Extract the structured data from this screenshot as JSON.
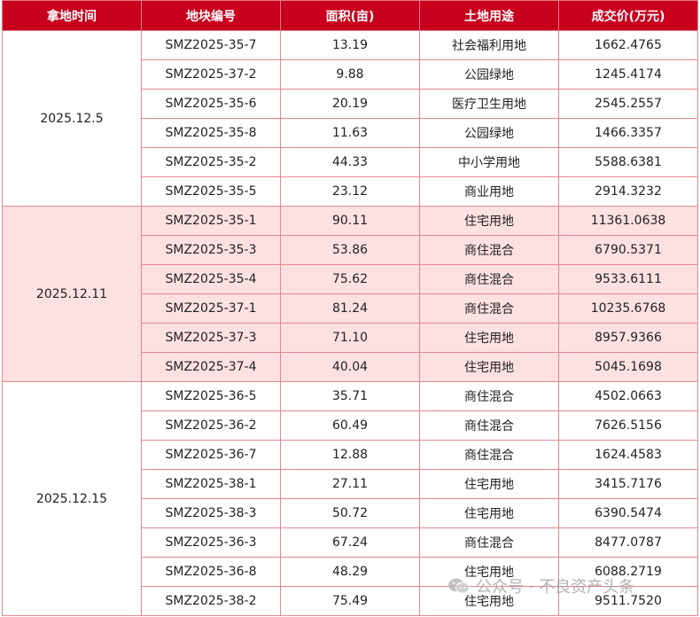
{
  "headers": [
    "拿地时间",
    "地块编号",
    "面积(亩)",
    "土地用途",
    "成交价(万元)"
  ],
  "groups": [
    {
      "date": "2025.12.5",
      "rows": [
        [
          "SMZ2025-35-7",
          "13.19",
          "社会福利用地",
          "1662.4765"
        ],
        [
          "SMZ2025-37-2",
          "9.88",
          "公园绿地",
          "1245.4174"
        ],
        [
          "SMZ2025-35-6",
          "20.19",
          "医疗卫生用地",
          "2545.2557"
        ],
        [
          "SMZ2025-35-8",
          "11.63",
          "公园绿地",
          "1466.3357"
        ],
        [
          "SMZ2025-35-2",
          "44.33",
          "中小学用地",
          "5588.6381"
        ],
        [
          "SMZ2025-35-5",
          "23.12",
          "商业用地",
          "2914.3232"
        ]
      ]
    },
    {
      "date": "2025.12.11",
      "rows": [
        [
          "SMZ2025-35-1",
          "90.11",
          "住宅用地",
          "11361.0638"
        ],
        [
          "SMZ2025-35-3",
          "53.86",
          "商住混合",
          "6790.5371"
        ],
        [
          "SMZ2025-35-4",
          "75.62",
          "商住混合",
          "9533.6111"
        ],
        [
          "SMZ2025-37-1",
          "81.24",
          "商住混合",
          "10235.6768"
        ],
        [
          "SMZ2025-37-3",
          "71.10",
          "住宅用地",
          "8957.9366"
        ],
        [
          "SMZ2025-37-4",
          "40.04",
          "住宅用地",
          "5045.1698"
        ]
      ]
    },
    {
      "date": "2025.12.15",
      "rows": [
        [
          "SMZ2025-36-5",
          "35.71",
          "商住混合",
          "4502.0663"
        ],
        [
          "SMZ2025-36-2",
          "60.49",
          "商住混合",
          "7626.5156"
        ],
        [
          "SMZ2025-36-7",
          "12.88",
          "商住混合",
          "1624.4583"
        ],
        [
          "SMZ2025-38-1",
          "27.11",
          "住宅用地",
          "3415.7176"
        ],
        [
          "SMZ2025-38-3",
          "50.72",
          "住宅用地",
          "6390.5474"
        ],
        [
          "SMZ2025-36-3",
          "67.24",
          "商住混合",
          "8477.0787"
        ],
        [
          "SMZ2025-36-8",
          "48.29",
          "住宅用地",
          "6088.2719"
        ],
        [
          "SMZ2025-38-2",
          "75.49",
          "住宅用地",
          "9511.7520"
        ]
      ]
    }
  ],
  "watermark": "公众号 · 不良资产头条",
  "watermark_icon": "wechat-icon",
  "colors": {
    "header_bg": "#c8001e",
    "header_text": "#ffffff",
    "highlight_bg": "#fde0e2",
    "border": "#e8868f"
  }
}
